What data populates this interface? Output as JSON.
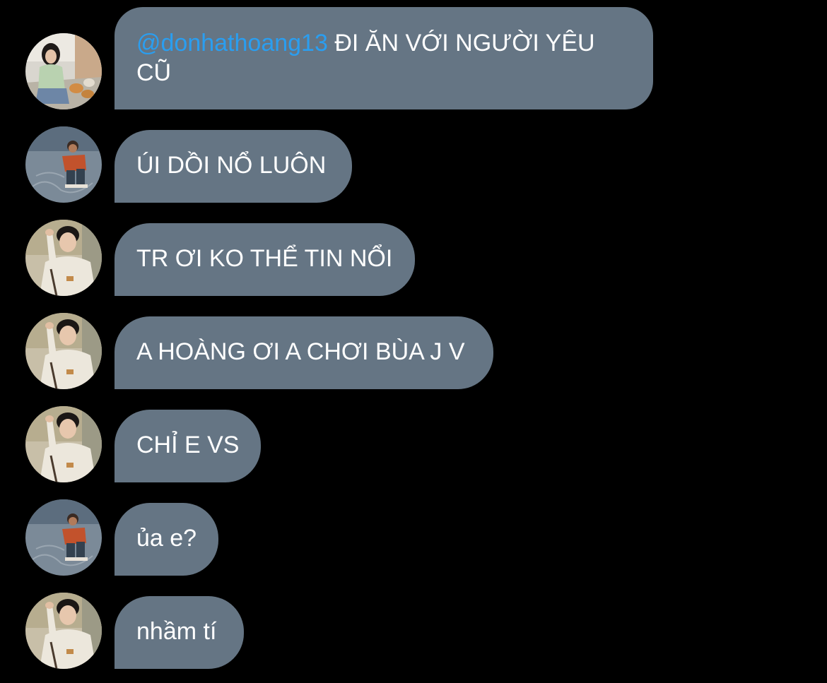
{
  "colors": {
    "background": "#000000",
    "bubble": "#657584",
    "text": "#ffffff",
    "mention": "#2a9ef0"
  },
  "messages": [
    {
      "avatar": "girl-with-cats-avatar",
      "mention": "@donhathoang13",
      "text": " ĐI ĂN VỚI NGƯỜI YÊU CŨ"
    },
    {
      "avatar": "man-crouching-avatar",
      "text": "ÚI DỒI NỔ LUÔN"
    },
    {
      "avatar": "boy-white-sweater-avatar",
      "text": "TR ƠI KO THỂ TIN NỔI"
    },
    {
      "avatar": "boy-white-sweater-avatar",
      "text": "A HOÀNG ƠI A CHƠI BÙA J V"
    },
    {
      "avatar": "boy-white-sweater-avatar",
      "text": "CHỈ E VS"
    },
    {
      "avatar": "man-crouching-avatar",
      "text": "ủa e?"
    },
    {
      "avatar": "boy-white-sweater-avatar",
      "text": "nhầm tí"
    }
  ]
}
